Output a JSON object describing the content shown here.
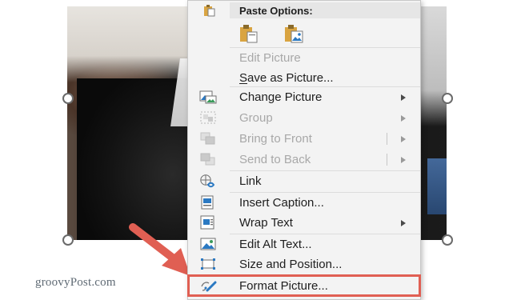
{
  "watermark": "groovyPost.com",
  "menu": {
    "paste_options_label": "Paste Options:",
    "items": [
      {
        "label": "Edit Picture",
        "disabled": true,
        "submenu": false
      },
      {
        "label": "Save as Picture...",
        "disabled": false,
        "submenu": false
      },
      {
        "label": "Change Picture",
        "disabled": false,
        "submenu": true
      },
      {
        "label": "Group",
        "disabled": true,
        "submenu": true
      },
      {
        "label": "Bring to Front",
        "disabled": true,
        "submenu": true,
        "split": true
      },
      {
        "label": "Send to Back",
        "disabled": true,
        "submenu": true,
        "split": true
      },
      {
        "label": "Link",
        "disabled": false,
        "submenu": false
      },
      {
        "label": "Insert Caption...",
        "disabled": false,
        "submenu": false
      },
      {
        "label": "Wrap Text",
        "disabled": false,
        "submenu": true
      },
      {
        "label": "Edit Alt Text...",
        "disabled": false,
        "submenu": false
      },
      {
        "label": "Size and Position...",
        "disabled": false,
        "submenu": false
      },
      {
        "label": "Format Picture...",
        "disabled": false,
        "submenu": false,
        "highlighted": true
      }
    ]
  },
  "colors": {
    "highlight_border": "#e05f53",
    "arrow": "#e05f53",
    "menu_bg": "#f3f3f3"
  },
  "icons": {
    "paste_header": "clipboard-icon",
    "paste_option_1": "paste-keep-source-icon",
    "paste_option_2": "paste-picture-icon",
    "change_picture": "change-picture-icon",
    "group": "group-icon",
    "bring_to_front": "bring-to-front-icon",
    "send_to_back": "send-to-back-icon",
    "link": "link-icon",
    "insert_caption": "insert-caption-icon",
    "wrap_text": "wrap-text-icon",
    "edit_alt_text": "alt-text-icon",
    "size_position": "size-position-icon",
    "format_picture": "format-picture-icon"
  }
}
